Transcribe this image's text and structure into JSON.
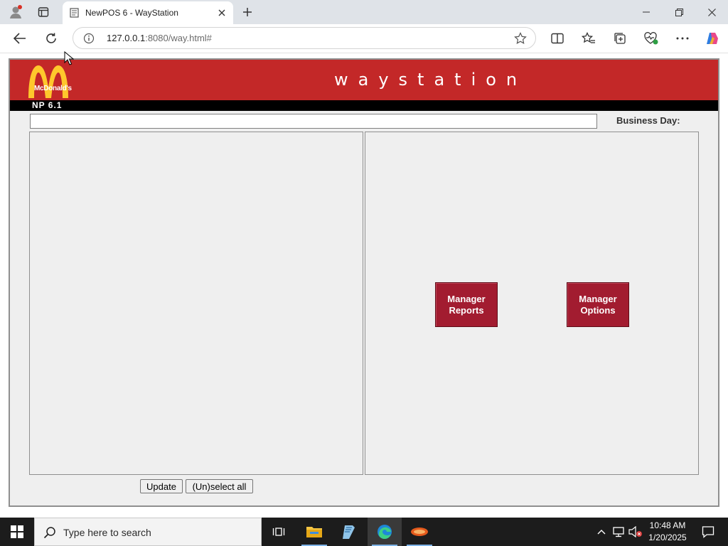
{
  "browser": {
    "tab_title": "NewPOS 6 - WayStation",
    "url_host": "127.0.0.1",
    "url_rest": ":8080/way.html#",
    "icons": {
      "profile": "profile-icon",
      "tab_actions": "tab-actions-icon",
      "favicon": "page-icon",
      "close_tab": "close-icon",
      "new_tab": "plus-icon",
      "minimize": "minimize-icon",
      "restore": "restore-icon",
      "close_window": "close-icon",
      "back": "back-arrow-icon",
      "refresh": "refresh-icon",
      "site_info": "info-icon",
      "favorite": "star-icon",
      "split_screen": "split-screen-icon",
      "favorites": "favorites-icon",
      "collections": "collections-icon",
      "browser_essentials": "heart-pulse-icon",
      "more": "more-icon",
      "copilot": "copilot-icon"
    }
  },
  "page": {
    "brand_text": "McDonald's",
    "app_title": "waystation",
    "version": "NP 6.1",
    "business_day_label": "Business Day:",
    "business_day_value": "",
    "buttons": {
      "manager_reports": "Manager\nReports",
      "manager_options": "Manager\nOptions",
      "update": "Update",
      "unselect_all": "(Un)select all"
    },
    "colors": {
      "header_red": "#c32828",
      "button_maroon": "#a21c30",
      "arches_yellow": "#ffc72c"
    }
  },
  "taskbar": {
    "search_placeholder": "Type here to search",
    "time": "10:48 AM",
    "date": "1/20/2025",
    "apps": [
      "task-view-icon",
      "file-explorer-icon",
      "notepad-icon",
      "edge-icon",
      "pos-app-icon"
    ],
    "tray_icons": [
      "chevron-up-icon",
      "network-icon",
      "volume-muted-icon",
      "notification-icon"
    ]
  }
}
